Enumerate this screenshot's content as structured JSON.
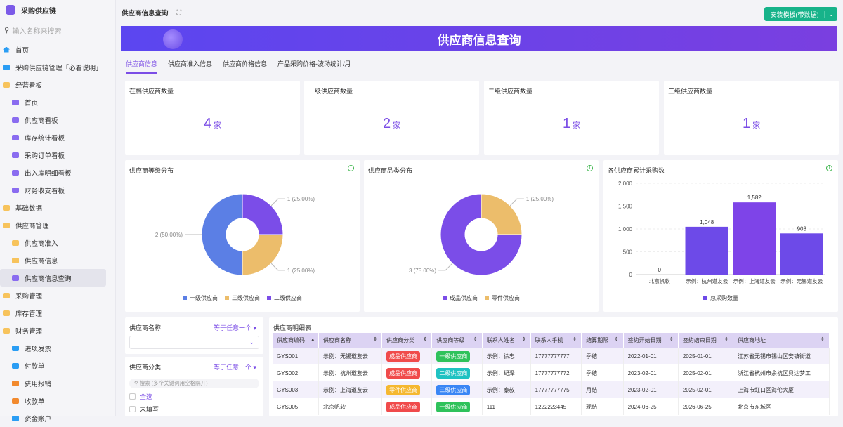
{
  "app": {
    "name": "采购供应链",
    "search_placeholder": "输入名称来搜索"
  },
  "sidebar": [
    {
      "label": "首页",
      "icon": "home-icon",
      "level": 0
    },
    {
      "label": "采购供应链管理「必看说明」",
      "icon": "doc-icon",
      "level": 0
    },
    {
      "label": "经营看板",
      "icon": "folder-icon",
      "level": 0
    },
    {
      "label": "首页",
      "icon": "dashboard-icon",
      "level": 1
    },
    {
      "label": "供应商看板",
      "icon": "dashboard-icon",
      "level": 1
    },
    {
      "label": "库存统计看板",
      "icon": "dashboard-icon",
      "level": 1
    },
    {
      "label": "采购订单看板",
      "icon": "dashboard-icon",
      "level": 1
    },
    {
      "label": "出入库明细看板",
      "icon": "dashboard-icon",
      "level": 1
    },
    {
      "label": "财务收支看板",
      "icon": "dashboard-icon",
      "level": 1
    },
    {
      "label": "基础数据",
      "icon": "folder-icon",
      "level": 0
    },
    {
      "label": "供应商管理",
      "icon": "folder-icon",
      "level": 0
    },
    {
      "label": "供应商准入",
      "icon": "folder-icon",
      "level": 1
    },
    {
      "label": "供应商信息",
      "icon": "folder-icon",
      "level": 1
    },
    {
      "label": "供应商信息查询",
      "icon": "dashboard-icon",
      "level": 1,
      "active": true
    },
    {
      "label": "采购管理",
      "icon": "folder-icon",
      "level": 0
    },
    {
      "label": "库存管理",
      "icon": "folder-icon",
      "level": 0
    },
    {
      "label": "财务管理",
      "icon": "folder-icon",
      "level": 0
    },
    {
      "label": "进项发票",
      "icon": "doc-icon",
      "level": 1
    },
    {
      "label": "付款单",
      "icon": "doc-icon",
      "level": 1
    },
    {
      "label": "费用报销",
      "icon": "wallet-icon",
      "level": 1
    },
    {
      "label": "收款单",
      "icon": "receipt-icon",
      "level": 1
    },
    {
      "label": "资金账户",
      "icon": "doc-icon",
      "level": 1
    }
  ],
  "header": {
    "title": "供应商信息查询",
    "install_label": "安装模板(带数据)"
  },
  "banner": {
    "title": "供应商信息查询"
  },
  "tabs": [
    "供应商信息",
    "供应商准入信息",
    "供应商价格信息",
    "产品采购价格-波动统计/月"
  ],
  "stats": [
    {
      "label": "在档供应商数量",
      "value": "4",
      "unit": "家"
    },
    {
      "label": "一级供应商数量",
      "value": "2",
      "unit": "家"
    },
    {
      "label": "二级供应商数量",
      "value": "1",
      "unit": "家"
    },
    {
      "label": "三级供应商数量",
      "value": "1",
      "unit": "家"
    }
  ],
  "colors": {
    "blue": "#5b7fe5",
    "purple": "#7b4de8",
    "yellow": "#ecbd6b",
    "bar": "#6d4ae8"
  },
  "chart_data": [
    {
      "type": "pie",
      "title": "供应商等级分布",
      "slices": [
        {
          "name": "二级供应商",
          "value": 1,
          "label": "1 (25.00%)",
          "color": "#7b4de8"
        },
        {
          "name": "三级供应商",
          "value": 1,
          "label": "1 (25.00%)",
          "color": "#ecbd6b"
        },
        {
          "name": "一级供应商",
          "value": 2,
          "label": "2 (50.00%)",
          "color": "#5b7fe5"
        }
      ],
      "legend": [
        "一级供应商",
        "三级供应商",
        "二级供应商"
      ]
    },
    {
      "type": "pie",
      "title": "供应商品类分布",
      "slices": [
        {
          "name": "零件供应商",
          "value": 1,
          "label": "1 (25.00%)",
          "color": "#ecbd6b"
        },
        {
          "name": "成品供应商",
          "value": 3,
          "label": "3 (75.00%)",
          "color": "#7b4de8"
        }
      ],
      "legend": [
        "成品供应商",
        "零件供应商"
      ]
    },
    {
      "type": "bar",
      "title": "各供应商累计采购数",
      "categories": [
        "北京帆软",
        "示例：杭州道友云",
        "示例：上海道友云",
        "示例：无锡道友云"
      ],
      "values": [
        0,
        1048,
        1582,
        903
      ],
      "value_labels": [
        "0",
        "1,048",
        "1,582",
        "903"
      ],
      "yticks": [
        "0",
        "500",
        "1,000",
        "1,500",
        "2,000"
      ],
      "ylim": [
        0,
        2000
      ],
      "series_name": "总采购数量"
    }
  ],
  "filters": [
    {
      "label": "供应商名称",
      "operator": "等于任意一个"
    },
    {
      "label": "供应商分类",
      "operator": "等于任意一个",
      "search_placeholder": "搜索 (多个关键词用空格隔开)",
      "options": [
        "全选",
        "未填写"
      ]
    }
  ],
  "table": {
    "title": "供应商明细表",
    "columns": [
      "供应商编码",
      "供应商名称",
      "供应商分类",
      "供应商等级",
      "联系人姓名",
      "联系人手机",
      "结算期限",
      "签约开始日期",
      "签约结束日期",
      "供应商地址"
    ],
    "rows": [
      [
        "GYS001",
        "示例：无锡道友云",
        "成品供应商",
        "一级供应商",
        "示例：徐忠",
        "17777777777",
        "季结",
        "2022-01-01",
        "2025-01-01",
        "江苏省无锡市锡山区安镇街道"
      ],
      [
        "GYS002",
        "示例：杭州道友云",
        "成品供应商",
        "二级供应商",
        "示例：纪泽",
        "17777777772",
        "季结",
        "2023-02-01",
        "2025-02-01",
        "浙江省杭州市余杭区贝达梦工"
      ],
      [
        "GYS003",
        "示例：上海道友云",
        "零件供应商",
        "三级供应商",
        "示例：泰叔",
        "17777777775",
        "月结",
        "2023-02-01",
        "2025-02-01",
        "上海市虹口区海伦大厦"
      ],
      [
        "GYS005",
        "北京帆软",
        "成品供应商",
        "一级供应商",
        "111",
        "1222223445",
        "现结",
        "2024-06-25",
        "2026-06-25",
        "北京市东城区"
      ]
    ]
  }
}
